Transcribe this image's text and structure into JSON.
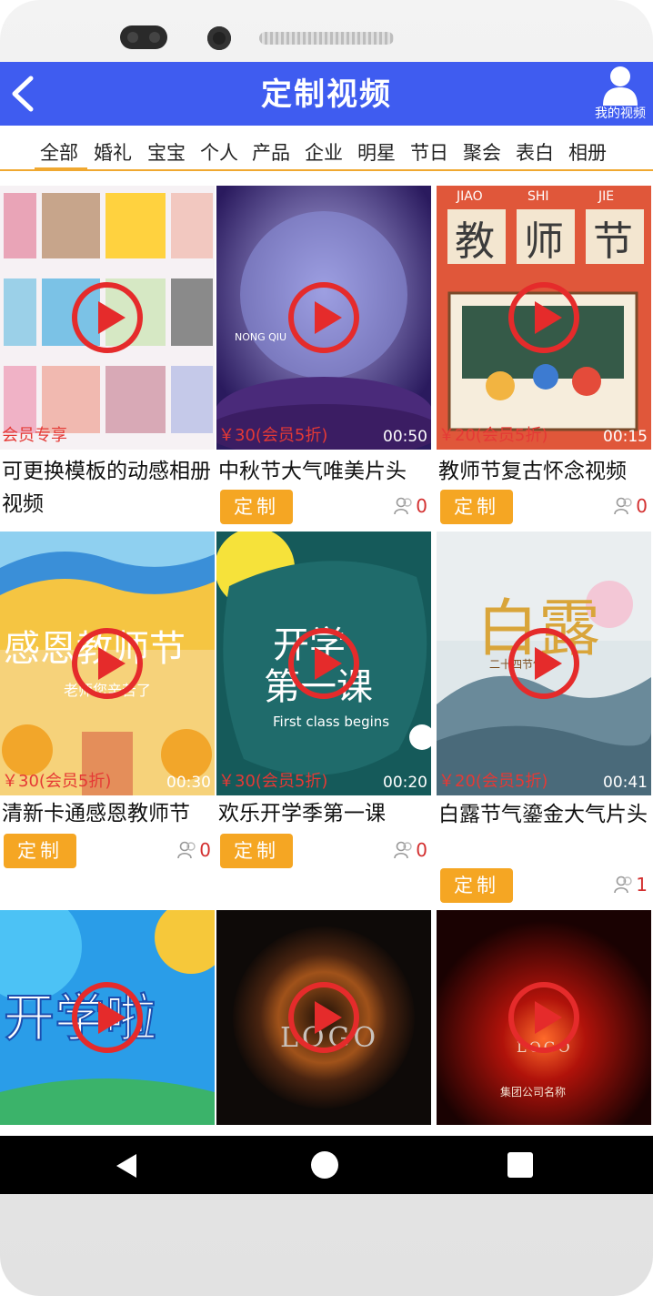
{
  "header": {
    "title": "定制视频",
    "my_videos_label": "我的视频"
  },
  "tabs": [
    "全部",
    "婚礼",
    "宝宝",
    "个人",
    "产品",
    "企业",
    "明星",
    "节日",
    "聚会",
    "表白",
    "相册"
  ],
  "active_tab": "全部",
  "colors": {
    "header": "#3f5cf0",
    "accent": "#f5a623",
    "price": "#e53935"
  },
  "button_label": "定制",
  "cards": [
    {
      "title": "可更换模板的动感相册视频",
      "badge": "会员专享"
    },
    {
      "title": "中秋节大气唯美片头",
      "price": "￥30(会员5折)",
      "duration": "00:50",
      "likes": "0"
    },
    {
      "title": "教师节复古怀念视频",
      "price": "￥20(会员5折)",
      "duration": "00:15",
      "likes": "0"
    },
    {
      "title": "清新卡通感恩教师节",
      "price": "￥30(会员5折)",
      "duration": "00:30",
      "likes": "0"
    },
    {
      "title": "欢乐开学季第一课",
      "price": "￥30(会员5折)",
      "duration": "00:20",
      "likes": "0"
    },
    {
      "title": "白露节气鎏金大气片头",
      "price": "￥20(会员5折)",
      "duration": "00:41",
      "likes": "1"
    }
  ],
  "thumb_text": {
    "mid_autumn_en": "NONG QIU",
    "teachers_day": [
      "JIAO",
      "SHI",
      "JIE",
      "教",
      "师",
      "节"
    ],
    "thanks_teacher": "感恩教师节",
    "thanks_sub": "老师您辛苦了",
    "first_class": [
      "开学",
      "第一课"
    ],
    "first_class_en": "First class begins",
    "bailu": "白露",
    "bailu_sub": "二十四节气",
    "kaixue": "开学啦",
    "logo": "LOGO",
    "company": "集团公司名称"
  }
}
